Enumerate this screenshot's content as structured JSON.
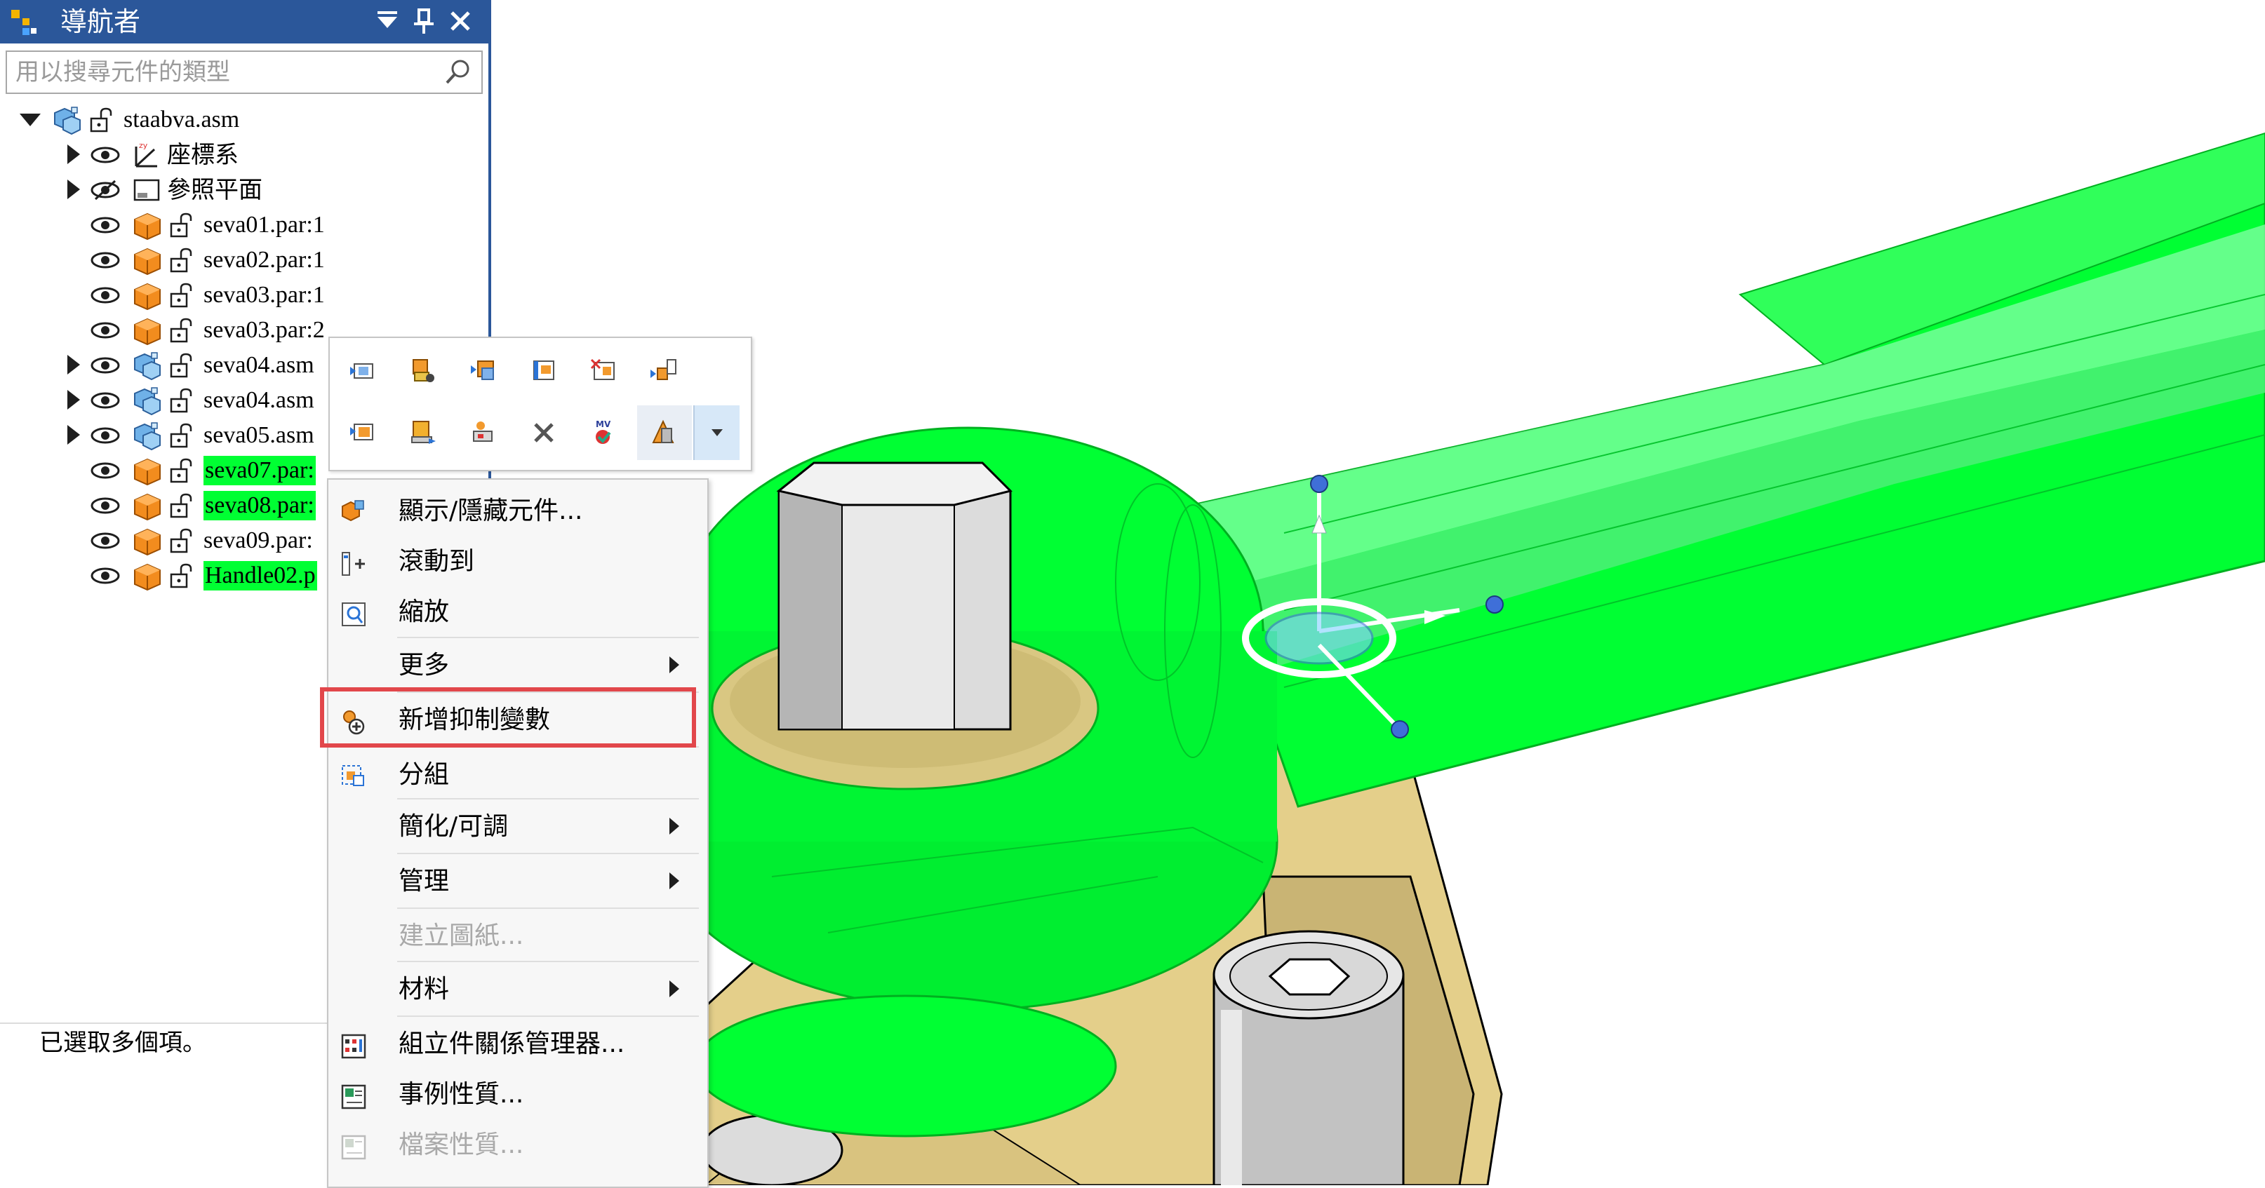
{
  "navigator": {
    "title": "導航者",
    "title_buttons": [
      "▾",
      "⊥",
      "✕"
    ],
    "search_placeholder": "用以搜尋元件的類型",
    "tree": [
      {
        "label": "staabva.asm",
        "icon": "assembly-icon",
        "expander": "down",
        "eye": "none",
        "lock": true,
        "highlight": false
      },
      {
        "label": "座標系",
        "icon": "coordinate-system-icon",
        "expander": "right",
        "eye": "visible",
        "lock": false,
        "highlight": false
      },
      {
        "label": "參照平面",
        "icon": "reference-plane-icon",
        "expander": "right",
        "eye": "hidden",
        "lock": false,
        "highlight": false
      },
      {
        "label": "seva01.par:1",
        "icon": "part-icon",
        "expander": "none",
        "eye": "visible",
        "lock": true,
        "highlight": false
      },
      {
        "label": "seva02.par:1",
        "icon": "part-icon",
        "expander": "none",
        "eye": "visible",
        "lock": true,
        "highlight": false
      },
      {
        "label": "seva03.par:1",
        "icon": "part-icon",
        "expander": "none",
        "eye": "visible",
        "lock": true,
        "highlight": false
      },
      {
        "label": "seva03.par:2",
        "icon": "part-icon",
        "expander": "none",
        "eye": "visible",
        "lock": true,
        "highlight": false
      },
      {
        "label": "seva04.asm",
        "icon": "assembly-icon",
        "expander": "right",
        "eye": "visible",
        "lock": true,
        "highlight": false
      },
      {
        "label": "seva04.asm",
        "icon": "assembly-icon",
        "expander": "right",
        "eye": "visible",
        "lock": true,
        "highlight": false
      },
      {
        "label": "seva05.asm",
        "icon": "assembly-icon",
        "expander": "right",
        "eye": "visible",
        "lock": true,
        "highlight": false
      },
      {
        "label": "seva07.par:",
        "icon": "part-icon",
        "expander": "none",
        "eye": "visible",
        "lock": true,
        "highlight": true
      },
      {
        "label": "seva08.par:",
        "icon": "part-icon",
        "expander": "none",
        "eye": "visible",
        "lock": true,
        "highlight": true
      },
      {
        "label": "seva09.par:",
        "icon": "part-icon",
        "expander": "none",
        "eye": "visible",
        "lock": true,
        "highlight": false
      },
      {
        "label": "Handle02.p",
        "icon": "part-icon",
        "expander": "none",
        "eye": "visible",
        "lock": true,
        "highlight": true
      }
    ],
    "status": "已選取多個項。"
  },
  "mini_toolbar": {
    "row1": [
      "show-only-icon",
      "show-all-parts-icon",
      "show-selected-icon",
      "hide-icon",
      "hide-others-icon",
      "fit-part-icon"
    ],
    "row2": [
      "show-parts-icon",
      "move-part-icon",
      "part-properties-icon",
      "delete-x-icon",
      "mv-icon",
      "transparent-icon"
    ],
    "dropdown_icon": "dropdown-arrow-icon"
  },
  "context_menu": {
    "items": [
      {
        "label": "顯示/隱藏元件...",
        "icon": "show-hide-components-icon",
        "submenu": false,
        "disabled": false
      },
      {
        "label": "滾動到",
        "icon": "scroll-to-icon",
        "submenu": false,
        "disabled": false
      },
      {
        "label": "縮放",
        "icon": "zoom-icon",
        "submenu": false,
        "disabled": false
      },
      {
        "label": "更多",
        "icon": "",
        "submenu": true,
        "disabled": false
      },
      {
        "label": "新增抑制變數",
        "icon": "add-suppression-variable-icon",
        "submenu": false,
        "disabled": false
      },
      {
        "label": "分組",
        "icon": "group-icon",
        "submenu": false,
        "disabled": false
      },
      {
        "label": "簡化/可調",
        "icon": "",
        "submenu": true,
        "disabled": false
      },
      {
        "label": "管理",
        "icon": "",
        "submenu": true,
        "disabled": false
      },
      {
        "label": "建立圖紙...",
        "icon": "",
        "submenu": false,
        "disabled": true
      },
      {
        "label": "材料",
        "icon": "",
        "submenu": true,
        "disabled": false
      },
      {
        "label": "組立件關係管理器...",
        "icon": "assembly-relationship-manager-icon",
        "submenu": false,
        "disabled": false
      },
      {
        "label": "事例性質...",
        "icon": "occurrence-properties-icon",
        "submenu": false,
        "disabled": false
      },
      {
        "label": "檔案性質...",
        "icon": "file-properties-icon",
        "submenu": false,
        "disabled": true
      }
    ],
    "highlighted_item": "新增抑制變數",
    "highlight_color": "#e2474b"
  },
  "viewport": {
    "selection_color": "#00ff33",
    "model_gold": "#e4cf8a",
    "model_gray": "#c9c9c9",
    "steering_wheel_handle_color": "#3f6fd8"
  }
}
